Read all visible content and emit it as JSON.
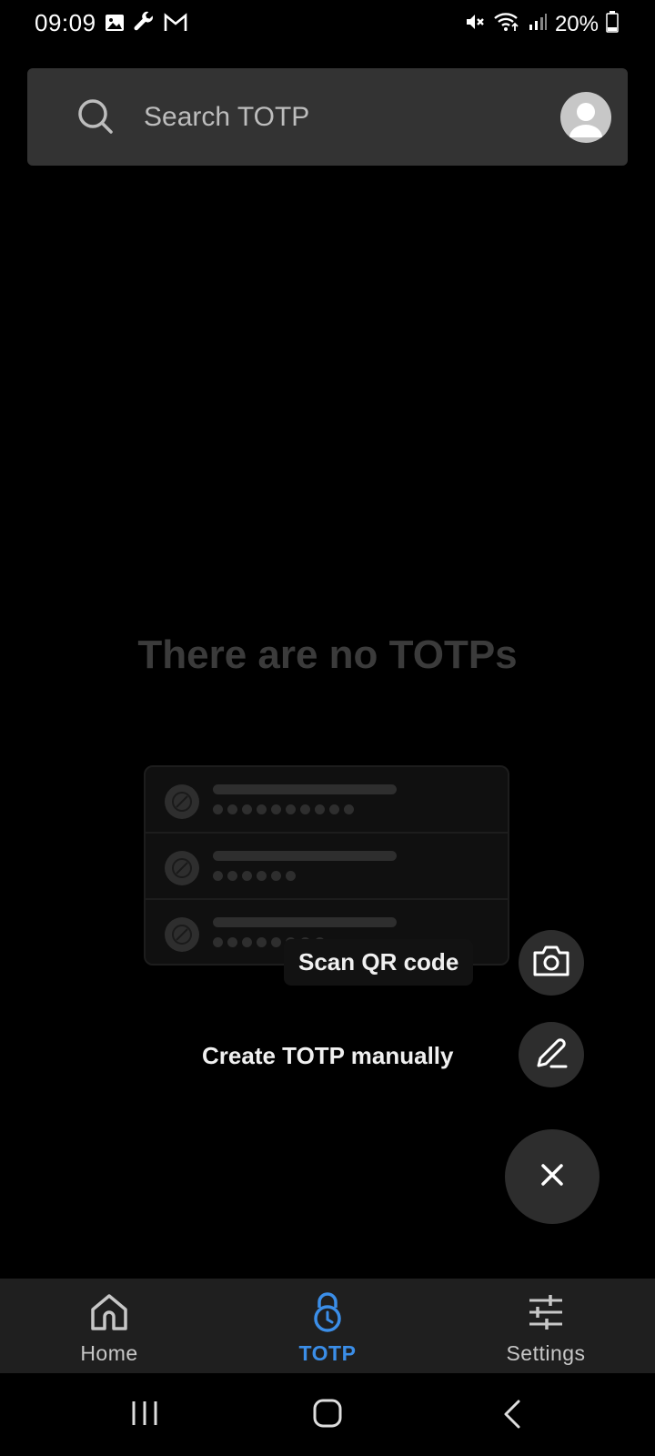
{
  "status_bar": {
    "time": "09:09",
    "left_icons": [
      "image-icon",
      "wrench-icon",
      "gmail-icon"
    ],
    "right_icons": [
      "mute-icon",
      "wifi-icon",
      "signal-icon",
      "battery-icon"
    ],
    "battery": "20%"
  },
  "search": {
    "placeholder": "Search TOTP",
    "value": ""
  },
  "empty_state": {
    "title": "There are no TOTPs"
  },
  "fab_menu": {
    "scan_label": "Scan QR code",
    "create_label": "Create TOTP manually"
  },
  "bottom_nav": {
    "items": [
      {
        "label": "Home",
        "icon": "home-icon",
        "active": false
      },
      {
        "label": "TOTP",
        "icon": "lock-clock-icon",
        "active": true
      },
      {
        "label": "Settings",
        "icon": "sliders-icon",
        "active": false
      }
    ]
  },
  "colors": {
    "accent": "#3b8ee8",
    "background": "#000000",
    "surface": "#333333"
  }
}
